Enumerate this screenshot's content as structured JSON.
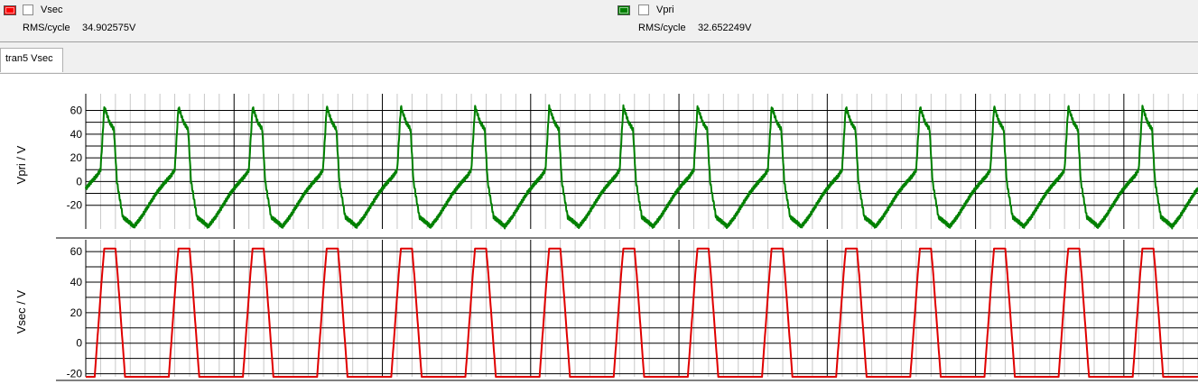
{
  "traces": [
    {
      "name": "Vsec",
      "color": "#ff0000",
      "rms_label": "RMS/cycle",
      "rms_value": "34.902575V"
    },
    {
      "name": "Vpri",
      "color": "#008000",
      "rms_label": "RMS/cycle",
      "rms_value": "32.652249V"
    }
  ],
  "tab": {
    "label": "tran5 Vsec"
  },
  "chart_data": [
    {
      "type": "line",
      "ylabel": "Vpri / V",
      "ylim": [
        -40,
        68
      ],
      "yticks": [
        -20,
        0,
        20,
        40,
        60
      ],
      "grid": true,
      "period": 1,
      "phase": 0.4,
      "cycles": 15,
      "series": [
        {
          "color": "#008000",
          "waveform": {
            "t": [
              0,
              0.05,
              0.15,
              0.25,
              0.35,
              0.45,
              0.55,
              0.6,
              0.65,
              0.72,
              0.78,
              0.82,
              0.9,
              1.0
            ],
            "v": [
              -35,
              -38,
              -30,
              -20,
              -10,
              -2,
              5,
              10,
              63,
              50,
              44,
              0,
              -30,
              -35
            ]
          }
        }
      ]
    },
    {
      "type": "line",
      "ylabel": "Vsec / V",
      "ylim": [
        -22,
        63
      ],
      "yticks": [
        -20,
        0,
        20,
        40,
        60
      ],
      "grid": true,
      "period": 1,
      "phase": 0.4,
      "cycles": 15,
      "series": [
        {
          "color": "#e00000",
          "waveform": {
            "t": [
              0,
              0.52,
              0.62,
              0.65,
              0.8,
              0.83,
              0.93,
              1.0
            ],
            "v": [
              -22,
              -22,
              45,
              62,
              62,
              45,
              -22,
              -22
            ]
          }
        }
      ]
    }
  ]
}
